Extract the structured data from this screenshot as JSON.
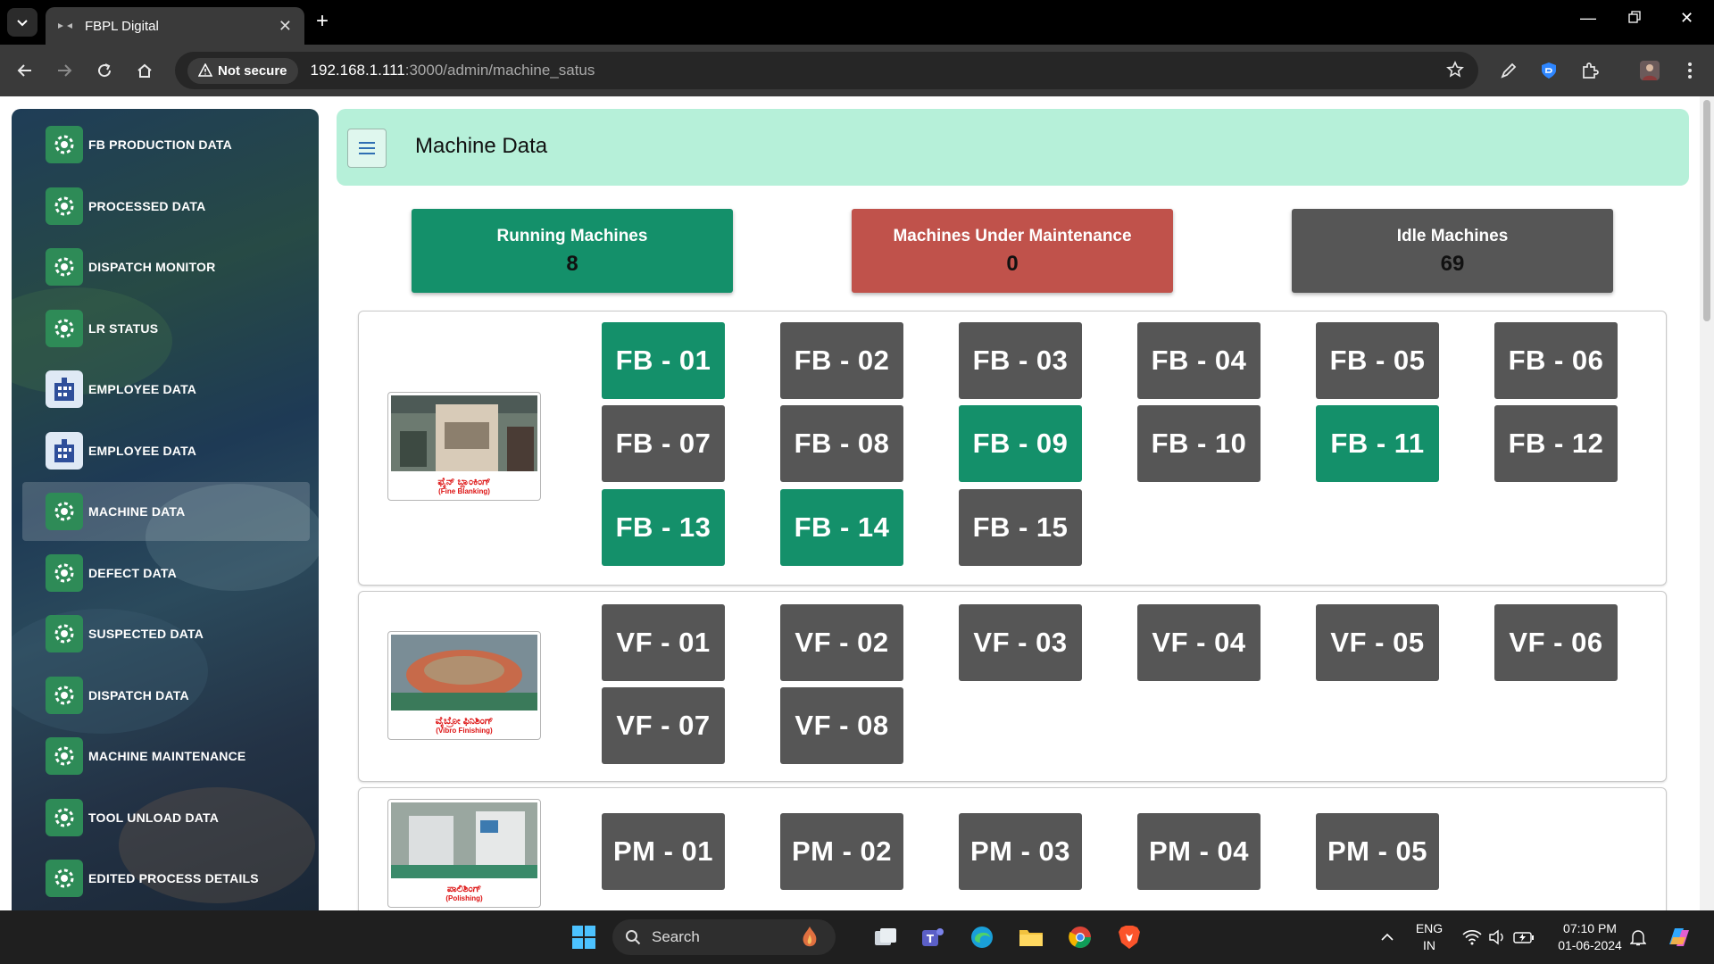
{
  "browser": {
    "tab_title": "FBPL Digital",
    "security_label": "Not secure",
    "url_host": "192.168.1.111",
    "url_path": ":3000/admin/machine_satus"
  },
  "sidebar": {
    "items": [
      {
        "label": "FB PRODUCTION DATA",
        "icon": "settings-cycle-icon"
      },
      {
        "label": "PROCESSED DATA",
        "icon": "gears-icon"
      },
      {
        "label": "DISPATCH MONITOR",
        "icon": "dispatch-truck-icon"
      },
      {
        "label": "LR STATUS",
        "icon": "truck-icon"
      },
      {
        "label": "EMPLOYEE DATA",
        "icon": "building-icon"
      },
      {
        "label": "EMPLOYEE DATA",
        "icon": "building-icon"
      },
      {
        "label": "MACHINE DATA",
        "icon": "machine-gears-icon"
      },
      {
        "label": "DEFECT DATA",
        "icon": "chart-gear-icon"
      },
      {
        "label": "SUSPECTED DATA",
        "icon": "refresh-gear-icon"
      },
      {
        "label": "DISPATCH DATA",
        "icon": "dispatch-truck-icon"
      },
      {
        "label": "MACHINE MAINTENANCE",
        "icon": "maintenance-icon"
      },
      {
        "label": "TOOL UNLOAD DATA",
        "icon": "tool-gear-icon"
      },
      {
        "label": "EDITED PROCESS DETAILS",
        "icon": "gears-icon"
      }
    ]
  },
  "header": {
    "title": "Machine Data"
  },
  "stats": {
    "running": {
      "label": "Running Machines",
      "value": "8",
      "color": "#14906a"
    },
    "maintenance": {
      "label": "Machines Under Maintenance",
      "value": "0",
      "color": "#c0524b"
    },
    "idle": {
      "label": "Idle Machines",
      "value": "69",
      "color": "#565656"
    }
  },
  "groups": [
    {
      "caption_local": "ಫೈನ್ ಬ್ಲಾಂಕಿಂಗ್",
      "caption_en": "(Fine Blanking)",
      "machines": [
        {
          "label": "FB - 01",
          "status": "running"
        },
        {
          "label": "FB - 02",
          "status": "idle"
        },
        {
          "label": "FB - 03",
          "status": "idle"
        },
        {
          "label": "FB - 04",
          "status": "idle"
        },
        {
          "label": "FB - 05",
          "status": "idle"
        },
        {
          "label": "FB - 06",
          "status": "idle"
        },
        {
          "label": "FB - 07",
          "status": "idle"
        },
        {
          "label": "FB - 08",
          "status": "idle"
        },
        {
          "label": "FB - 09",
          "status": "running"
        },
        {
          "label": "FB - 10",
          "status": "idle"
        },
        {
          "label": "FB - 11",
          "status": "running"
        },
        {
          "label": "FB - 12",
          "status": "idle"
        },
        {
          "label": "FB - 13",
          "status": "running"
        },
        {
          "label": "FB - 14",
          "status": "running"
        },
        {
          "label": "FB - 15",
          "status": "idle"
        }
      ]
    },
    {
      "caption_local": "ವೈಬ್ರೋ ಫಿನಿಶಿಂಗ್",
      "caption_en": "(Vibro Finishing)",
      "machines": [
        {
          "label": "VF - 01",
          "status": "idle"
        },
        {
          "label": "VF - 02",
          "status": "idle"
        },
        {
          "label": "VF - 03",
          "status": "idle"
        },
        {
          "label": "VF - 04",
          "status": "idle"
        },
        {
          "label": "VF - 05",
          "status": "idle"
        },
        {
          "label": "VF - 06",
          "status": "idle"
        },
        {
          "label": "VF - 07",
          "status": "idle"
        },
        {
          "label": "VF - 08",
          "status": "idle"
        }
      ]
    },
    {
      "caption_local": "ಪಾಲಿಶಿಂಗ್",
      "caption_en": "(Polishing)",
      "machines": [
        {
          "label": "PM - 01",
          "status": "idle"
        },
        {
          "label": "PM - 02",
          "status": "idle"
        },
        {
          "label": "PM - 03",
          "status": "idle"
        },
        {
          "label": "PM - 04",
          "status": "idle"
        },
        {
          "label": "PM - 05",
          "status": "idle"
        }
      ]
    }
  ],
  "taskbar": {
    "search_placeholder": "Search",
    "lang_line1": "ENG",
    "lang_line2": "IN",
    "time": "07:10 PM",
    "date": "01-06-2024"
  }
}
